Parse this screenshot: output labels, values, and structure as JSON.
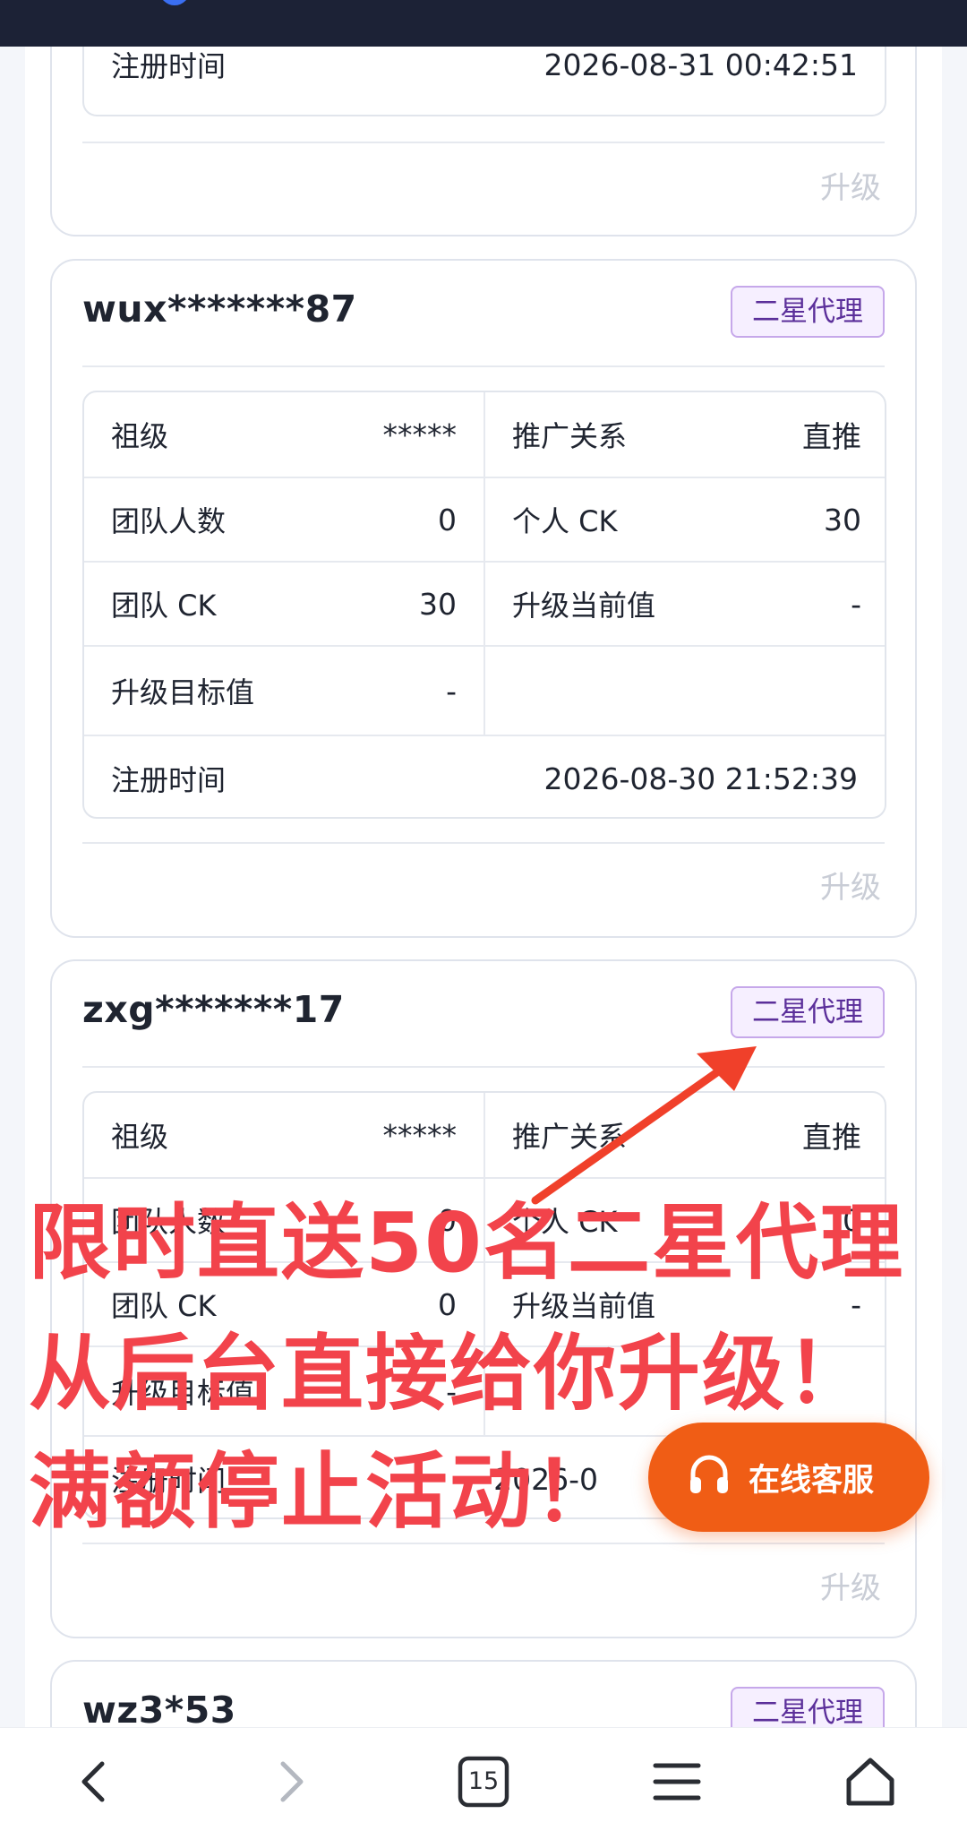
{
  "cards": [
    {
      "register_label": "注册时间",
      "register_value": "2026-08-31 00:42:51",
      "upgrade_label": "升级"
    },
    {
      "username": "wux*******87",
      "badge": "二星代理",
      "rows": [
        {
          "l_label": "祖级",
          "l_value": "*****",
          "r_label": "推广关系",
          "r_value": "直推"
        },
        {
          "l_label": "团队人数",
          "l_value": "0",
          "r_label": "个人 CK",
          "r_value": "30"
        },
        {
          "l_label": "团队 CK",
          "l_value": "30",
          "r_label": "升级当前值",
          "r_value": "-"
        },
        {
          "l_label": "升级目标值",
          "l_value": "-"
        }
      ],
      "register_label": "注册时间",
      "register_value": "2026-08-30 21:52:39",
      "upgrade_label": "升级"
    },
    {
      "username": "zxg*******17",
      "badge": "二星代理",
      "rows": [
        {
          "l_label": "祖级",
          "l_value": "*****",
          "r_label": "推广关系",
          "r_value": "直推"
        },
        {
          "l_label": "团队人数",
          "l_value": "0",
          "r_label": "个人 CK",
          "r_value": "0"
        },
        {
          "l_label": "团队 CK",
          "l_value": "0",
          "r_label": "升级当前值",
          "r_value": "-"
        },
        {
          "l_label": "升级目标值",
          "l_value": "-"
        }
      ],
      "register_label": "注册时间",
      "register_value": "2026-0",
      "upgrade_label": "升级"
    },
    {
      "username": "wz3*53",
      "badge": "二星代理"
    }
  ],
  "promo": {
    "line1": "限时直送50名二星代理",
    "line2": "从后台直接给你升级！",
    "line3": "满额停止活动！",
    "color": "#f2434b"
  },
  "customer_service": {
    "label": "在线客服",
    "icon": "headset-icon",
    "color": "#f05d15"
  },
  "bottom_nav": {
    "tab_count": "15",
    "icons": [
      "back-icon",
      "forward-icon",
      "tabs-icon",
      "menu-icon",
      "home-icon"
    ]
  }
}
